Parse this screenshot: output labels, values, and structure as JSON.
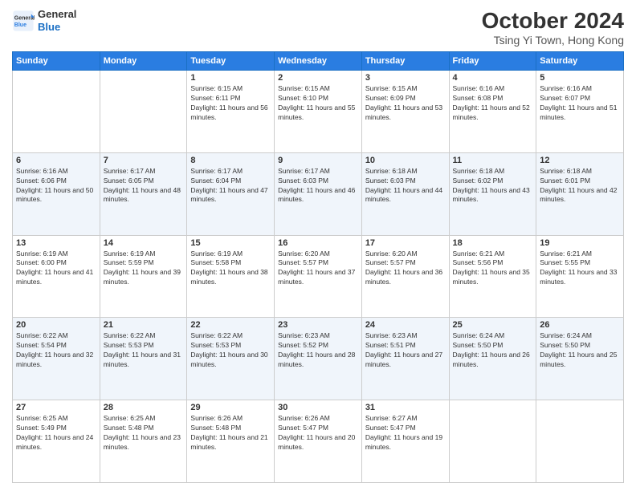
{
  "header": {
    "logo_line1": "General",
    "logo_line2": "Blue",
    "title": "October 2024",
    "subtitle": "Tsing Yi Town, Hong Kong"
  },
  "days_of_week": [
    "Sunday",
    "Monday",
    "Tuesday",
    "Wednesday",
    "Thursday",
    "Friday",
    "Saturday"
  ],
  "weeks": [
    [
      {
        "day": "",
        "info": ""
      },
      {
        "day": "",
        "info": ""
      },
      {
        "day": "1",
        "info": "Sunrise: 6:15 AM\nSunset: 6:11 PM\nDaylight: 11 hours and 56 minutes."
      },
      {
        "day": "2",
        "info": "Sunrise: 6:15 AM\nSunset: 6:10 PM\nDaylight: 11 hours and 55 minutes."
      },
      {
        "day": "3",
        "info": "Sunrise: 6:15 AM\nSunset: 6:09 PM\nDaylight: 11 hours and 53 minutes."
      },
      {
        "day": "4",
        "info": "Sunrise: 6:16 AM\nSunset: 6:08 PM\nDaylight: 11 hours and 52 minutes."
      },
      {
        "day": "5",
        "info": "Sunrise: 6:16 AM\nSunset: 6:07 PM\nDaylight: 11 hours and 51 minutes."
      }
    ],
    [
      {
        "day": "6",
        "info": "Sunrise: 6:16 AM\nSunset: 6:06 PM\nDaylight: 11 hours and 50 minutes."
      },
      {
        "day": "7",
        "info": "Sunrise: 6:17 AM\nSunset: 6:05 PM\nDaylight: 11 hours and 48 minutes."
      },
      {
        "day": "8",
        "info": "Sunrise: 6:17 AM\nSunset: 6:04 PM\nDaylight: 11 hours and 47 minutes."
      },
      {
        "day": "9",
        "info": "Sunrise: 6:17 AM\nSunset: 6:03 PM\nDaylight: 11 hours and 46 minutes."
      },
      {
        "day": "10",
        "info": "Sunrise: 6:18 AM\nSunset: 6:03 PM\nDaylight: 11 hours and 44 minutes."
      },
      {
        "day": "11",
        "info": "Sunrise: 6:18 AM\nSunset: 6:02 PM\nDaylight: 11 hours and 43 minutes."
      },
      {
        "day": "12",
        "info": "Sunrise: 6:18 AM\nSunset: 6:01 PM\nDaylight: 11 hours and 42 minutes."
      }
    ],
    [
      {
        "day": "13",
        "info": "Sunrise: 6:19 AM\nSunset: 6:00 PM\nDaylight: 11 hours and 41 minutes."
      },
      {
        "day": "14",
        "info": "Sunrise: 6:19 AM\nSunset: 5:59 PM\nDaylight: 11 hours and 39 minutes."
      },
      {
        "day": "15",
        "info": "Sunrise: 6:19 AM\nSunset: 5:58 PM\nDaylight: 11 hours and 38 minutes."
      },
      {
        "day": "16",
        "info": "Sunrise: 6:20 AM\nSunset: 5:57 PM\nDaylight: 11 hours and 37 minutes."
      },
      {
        "day": "17",
        "info": "Sunrise: 6:20 AM\nSunset: 5:57 PM\nDaylight: 11 hours and 36 minutes."
      },
      {
        "day": "18",
        "info": "Sunrise: 6:21 AM\nSunset: 5:56 PM\nDaylight: 11 hours and 35 minutes."
      },
      {
        "day": "19",
        "info": "Sunrise: 6:21 AM\nSunset: 5:55 PM\nDaylight: 11 hours and 33 minutes."
      }
    ],
    [
      {
        "day": "20",
        "info": "Sunrise: 6:22 AM\nSunset: 5:54 PM\nDaylight: 11 hours and 32 minutes."
      },
      {
        "day": "21",
        "info": "Sunrise: 6:22 AM\nSunset: 5:53 PM\nDaylight: 11 hours and 31 minutes."
      },
      {
        "day": "22",
        "info": "Sunrise: 6:22 AM\nSunset: 5:53 PM\nDaylight: 11 hours and 30 minutes."
      },
      {
        "day": "23",
        "info": "Sunrise: 6:23 AM\nSunset: 5:52 PM\nDaylight: 11 hours and 28 minutes."
      },
      {
        "day": "24",
        "info": "Sunrise: 6:23 AM\nSunset: 5:51 PM\nDaylight: 11 hours and 27 minutes."
      },
      {
        "day": "25",
        "info": "Sunrise: 6:24 AM\nSunset: 5:50 PM\nDaylight: 11 hours and 26 minutes."
      },
      {
        "day": "26",
        "info": "Sunrise: 6:24 AM\nSunset: 5:50 PM\nDaylight: 11 hours and 25 minutes."
      }
    ],
    [
      {
        "day": "27",
        "info": "Sunrise: 6:25 AM\nSunset: 5:49 PM\nDaylight: 11 hours and 24 minutes."
      },
      {
        "day": "28",
        "info": "Sunrise: 6:25 AM\nSunset: 5:48 PM\nDaylight: 11 hours and 23 minutes."
      },
      {
        "day": "29",
        "info": "Sunrise: 6:26 AM\nSunset: 5:48 PM\nDaylight: 11 hours and 21 minutes."
      },
      {
        "day": "30",
        "info": "Sunrise: 6:26 AM\nSunset: 5:47 PM\nDaylight: 11 hours and 20 minutes."
      },
      {
        "day": "31",
        "info": "Sunrise: 6:27 AM\nSunset: 5:47 PM\nDaylight: 11 hours and 19 minutes."
      },
      {
        "day": "",
        "info": ""
      },
      {
        "day": "",
        "info": ""
      }
    ]
  ]
}
